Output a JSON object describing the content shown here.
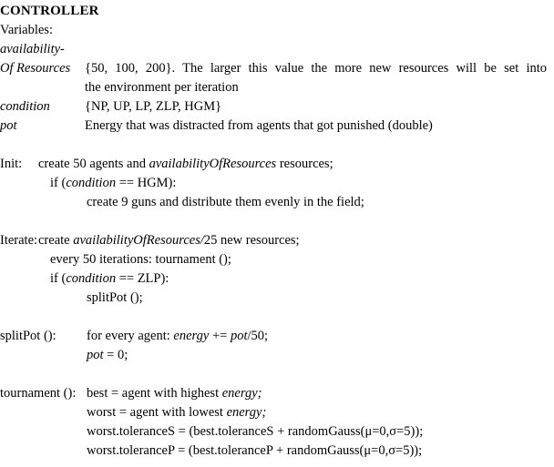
{
  "document": {
    "title": "CONTROLLER",
    "variables_heading": "Variables:",
    "variables": [
      {
        "name_line1": "availability-",
        "name_line2": "Of Resources",
        "name_plain": "availabilityOfResources",
        "description_line1": "{50, 100, 200}. The larger this value the more new resources will be set into",
        "description_line2": "the environment per iteration"
      },
      {
        "name": "condition",
        "description": "{NP, UP, LP, ZLP, HGM}"
      },
      {
        "name": "pot",
        "description": "Energy that was distracted from agents that got punished (double)"
      }
    ],
    "blocks": [
      {
        "id": "init",
        "label": "Init:",
        "lines": [
          {
            "indent": 0,
            "parts": [
              {
                "text": "create 50 agents and ",
                "style": "normal"
              },
              {
                "text": "availabilityOfResources",
                "style": "italic"
              },
              {
                "text": " resources;",
                "style": "normal"
              }
            ]
          },
          {
            "indent": 1,
            "parts": [
              {
                "text": "if (",
                "style": "normal"
              },
              {
                "text": "condition",
                "style": "italic"
              },
              {
                "text": " == HGM):",
                "style": "normal"
              }
            ]
          },
          {
            "indent": 2,
            "parts": [
              {
                "text": "create 9 guns and distribute them evenly in the field;",
                "style": "normal"
              }
            ]
          }
        ]
      },
      {
        "id": "iterate",
        "label": "Iterate:",
        "lines": [
          {
            "indent": 0,
            "parts": [
              {
                "text": "create ",
                "style": "normal"
              },
              {
                "text": "availabilityOfResources/",
                "style": "italic"
              },
              {
                "text": "25  new resources;",
                "style": "normal"
              }
            ]
          },
          {
            "indent": 1,
            "parts": [
              {
                "text": "every 50 iterations: tournament ();",
                "style": "normal"
              }
            ]
          },
          {
            "indent": 1,
            "parts": [
              {
                "text": "if (",
                "style": "normal"
              },
              {
                "text": "condition",
                "style": "italic"
              },
              {
                "text": " == ZLP):",
                "style": "normal"
              }
            ]
          },
          {
            "indent": 2,
            "parts": [
              {
                "text": "splitPot ();",
                "style": "normal"
              }
            ]
          }
        ]
      },
      {
        "id": "splitpot",
        "label": "splitPot ():",
        "lines": [
          {
            "indent": 0,
            "parts": [
              {
                "text": "for every agent: ",
                "style": "normal"
              },
              {
                "text": "energy",
                "style": "italic"
              },
              {
                "text": " += ",
                "style": "normal"
              },
              {
                "text": "pot",
                "style": "italic"
              },
              {
                "text": "/50;",
                "style": "normal"
              }
            ]
          },
          {
            "indent": 0,
            "parts": [
              {
                "text": "pot",
                "style": "italic"
              },
              {
                "text": " = 0;",
                "style": "normal"
              }
            ]
          }
        ]
      },
      {
        "id": "tournament",
        "label": "tournament ():",
        "lines": [
          {
            "indent": 0,
            "parts": [
              {
                "text": "best = agent with highest ",
                "style": "normal"
              },
              {
                "text": "energy;",
                "style": "italic"
              }
            ]
          },
          {
            "indent": 0,
            "parts": [
              {
                "text": "worst = agent with lowest ",
                "style": "normal"
              },
              {
                "text": "energy;",
                "style": "italic"
              }
            ]
          },
          {
            "indent": 0,
            "parts": [
              {
                "text": "worst.toleranceS = (best.toleranceS + randomGauss(μ=0,σ=5));",
                "style": "normal"
              }
            ]
          },
          {
            "indent": 0,
            "parts": [
              {
                "text": "worst.toleranceP = (best.toleranceP + randomGauss(μ=0,σ=5));",
                "style": "normal"
              }
            ]
          }
        ]
      }
    ]
  },
  "colors": {
    "background": "#ffffff",
    "text": "#000000"
  }
}
